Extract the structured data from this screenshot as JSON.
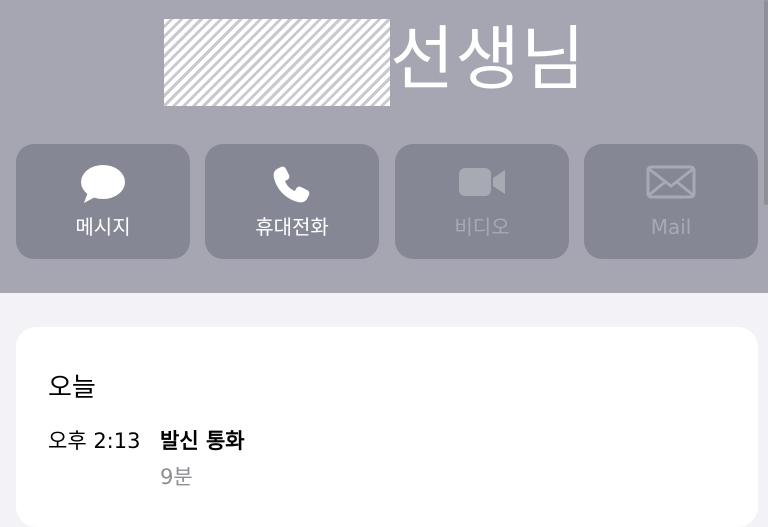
{
  "contact": {
    "name": "선생님"
  },
  "actions": [
    {
      "label": "메시지",
      "icon": "message-bubble-icon",
      "enabled": true
    },
    {
      "label": "휴대전화",
      "icon": "phone-icon",
      "enabled": true
    },
    {
      "label": "비디오",
      "icon": "video-camera-icon",
      "enabled": false
    },
    {
      "label": "Mail",
      "icon": "mail-envelope-icon",
      "enabled": false
    }
  ],
  "recents": {
    "day": "오늘",
    "entries": [
      {
        "time": "오후 2:13",
        "type": "발신 통화",
        "duration": "9분"
      }
    ]
  },
  "colors": {
    "header_bg": "#a5a6b1",
    "button_bg": "#858894",
    "button_label": "#ffffff",
    "button_label_disabled": "#a7a9b3",
    "page_bg": "#f2f2f7",
    "card_bg": "#ffffff",
    "secondary_text": "#8e8e93"
  }
}
